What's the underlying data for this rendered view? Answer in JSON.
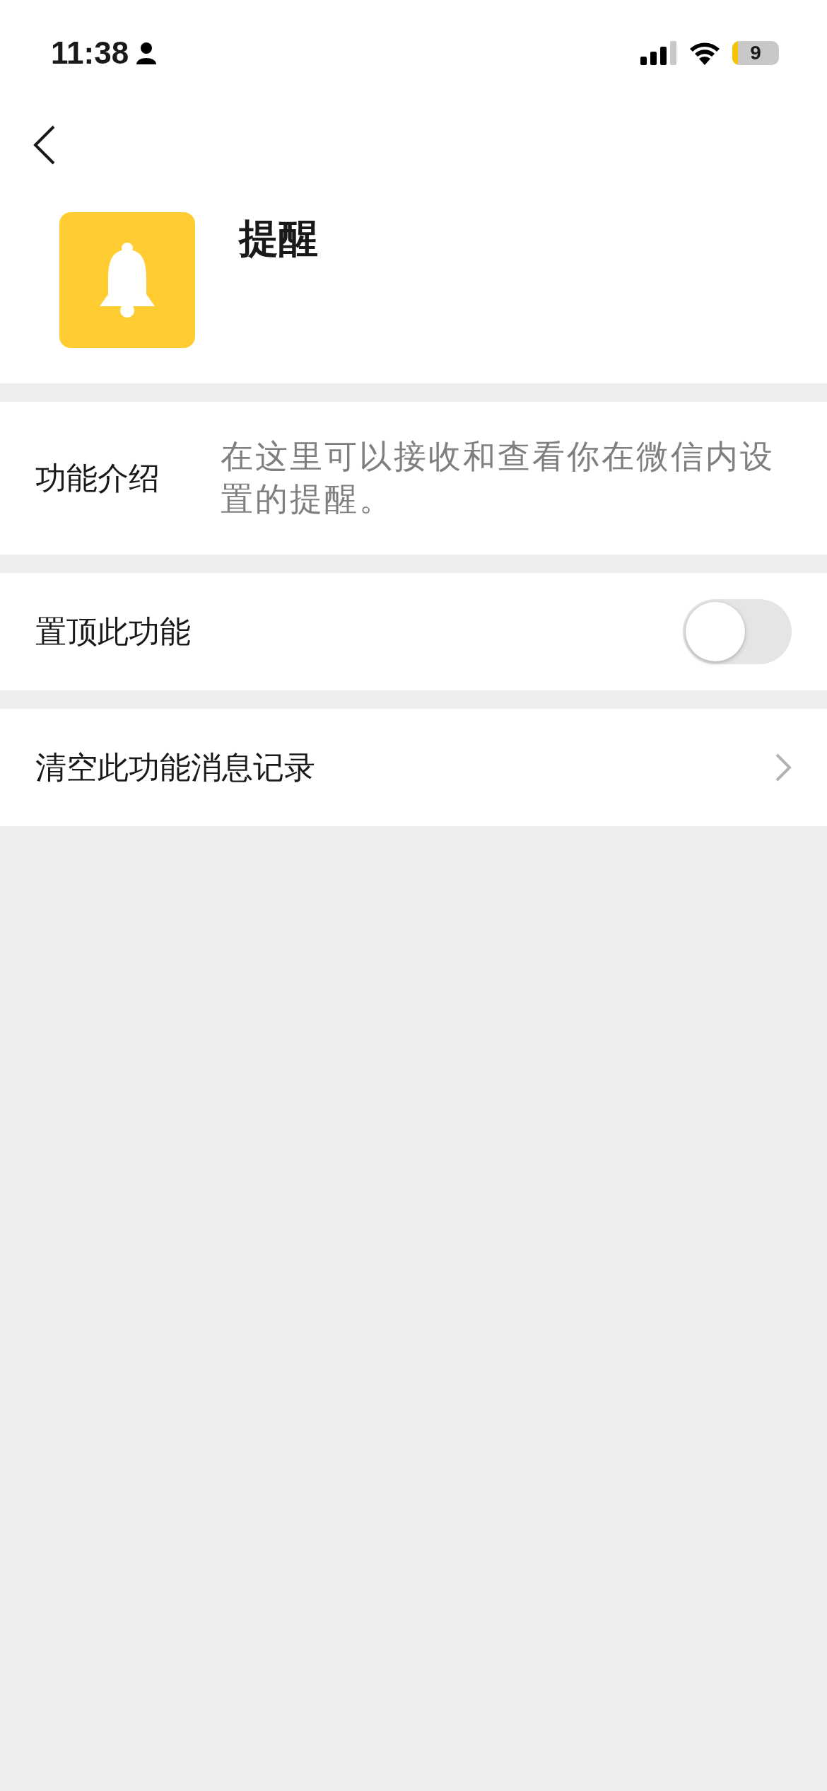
{
  "status_bar": {
    "time": "11:38",
    "battery": "9"
  },
  "header": {
    "title": "提醒"
  },
  "intro": {
    "label": "功能介绍",
    "text": "在这里可以接收和查看你在微信内设置的提醒。"
  },
  "settings": [
    {
      "kind": "toggle",
      "label": "置顶此功能",
      "on": false
    },
    {
      "kind": "link",
      "label": "清空此功能消息记录"
    }
  ]
}
